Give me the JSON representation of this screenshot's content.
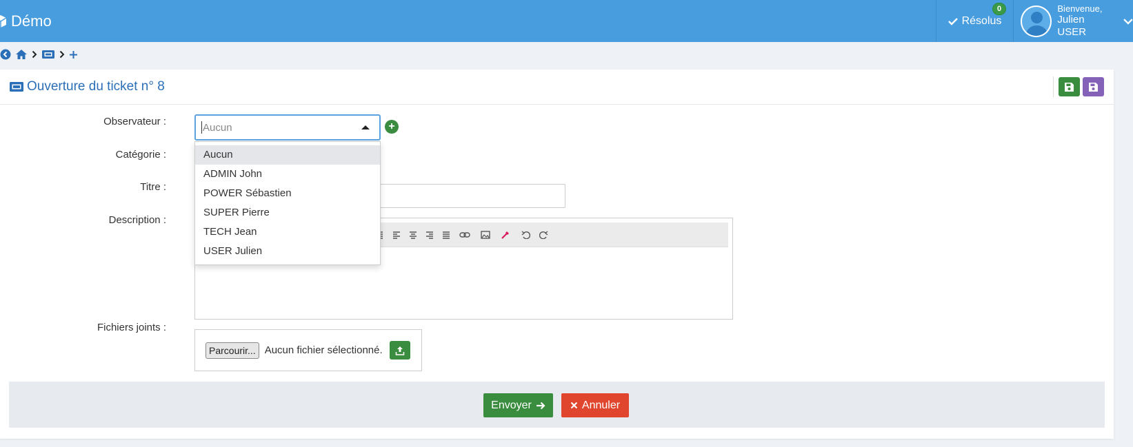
{
  "header": {
    "app_name": "Démo",
    "resolved_label": "Résolus",
    "resolved_count": "0",
    "welcome": "Bienvenue,",
    "user_name": "Julien USER"
  },
  "breadcrumb": {
    "items": [
      "back-icon",
      "home-icon",
      "ticket-icon",
      "plus-icon"
    ]
  },
  "card": {
    "title": "Ouverture du ticket n° 8"
  },
  "form": {
    "observer_label": "Observateur :",
    "observer_placeholder": "Aucun",
    "category_label": "Catégorie :",
    "title_label": "Titre :",
    "description_label": "Description :",
    "files_label": "Fichiers joints :",
    "browse_label": "Parcourir...",
    "no_file": "Aucun fichier sélectionné.",
    "observer_options": [
      "Aucun",
      "ADMIN John",
      "POWER Sébastien",
      "SUPER Pierre",
      "TECH Jean",
      "USER Julien"
    ],
    "highlighted_option": "Aucun"
  },
  "actions": {
    "send_label": "Envoyer",
    "cancel_label": "Annuler"
  },
  "colors": {
    "topbar": "#489ddf",
    "accent": "#2a6fb8",
    "green": "#3a8d3e",
    "purple": "#8362b8",
    "red": "#e0452d"
  }
}
